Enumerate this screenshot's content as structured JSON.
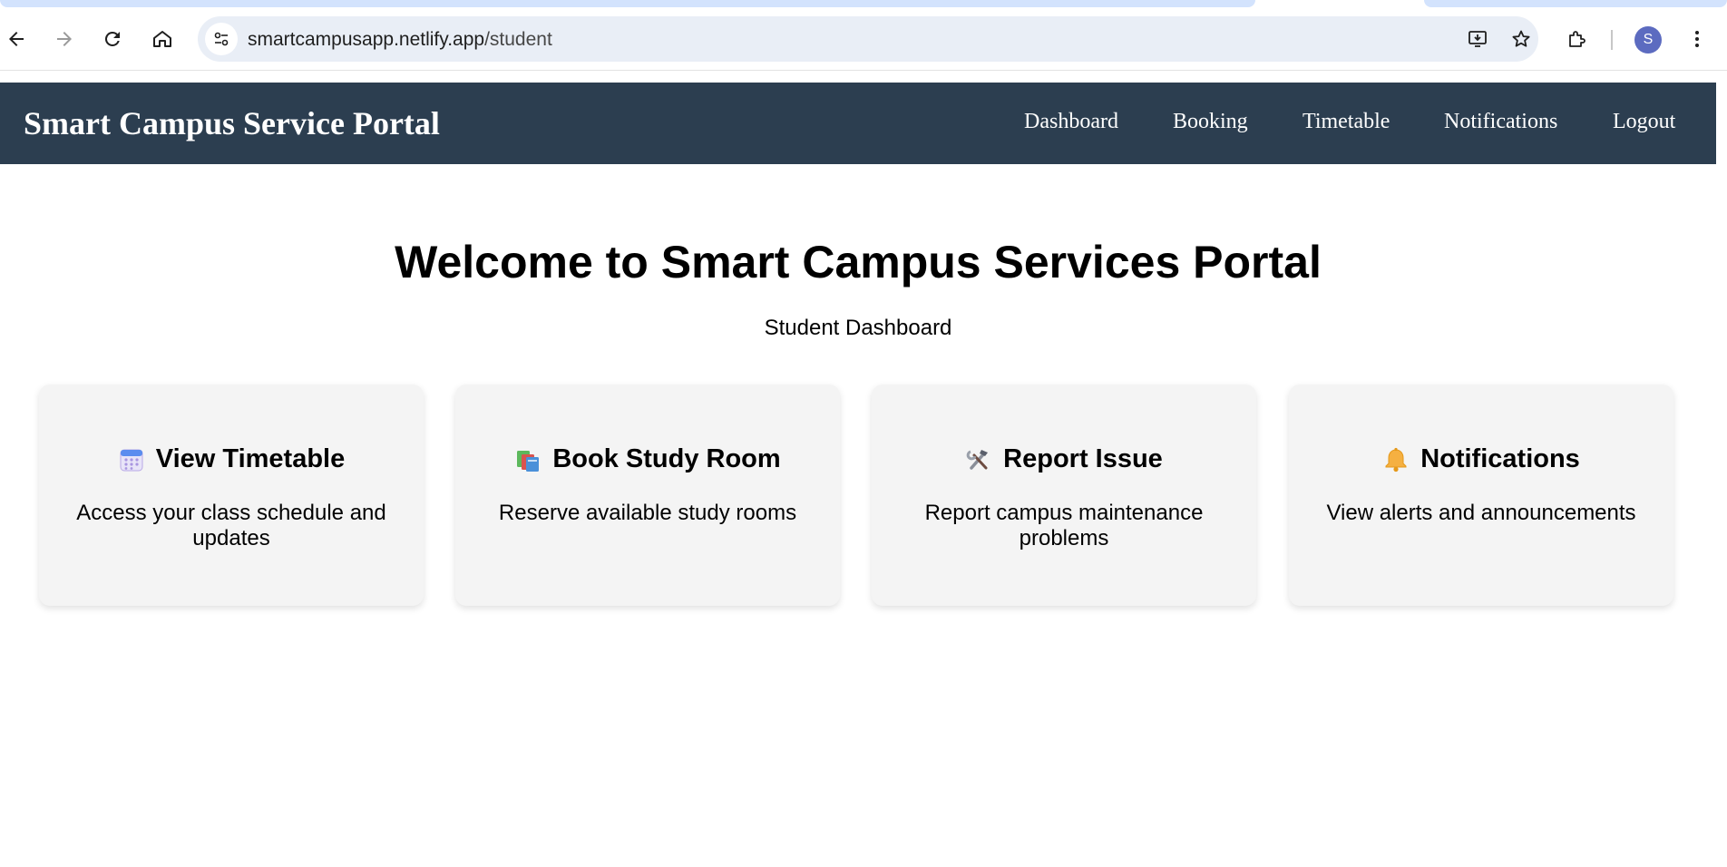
{
  "browser": {
    "url_host": "smartcampusapp.netlify.app",
    "url_path": "/student",
    "profile_initial": "S"
  },
  "header": {
    "brand": "Smart Campus Service Portal",
    "nav": [
      "Dashboard",
      "Booking",
      "Timetable",
      "Notifications",
      "Logout"
    ]
  },
  "main": {
    "title": "Welcome to Smart Campus Services Portal",
    "subtitle": "Student Dashboard",
    "cards": [
      {
        "icon": "calendar-icon",
        "title": "View Timetable",
        "description": "Access your class schedule and updates"
      },
      {
        "icon": "books-icon",
        "title": "Book Study Room",
        "description": "Reserve available study rooms"
      },
      {
        "icon": "hammer-wrench-icon",
        "title": "Report Issue",
        "description": "Report campus maintenance problems"
      },
      {
        "icon": "bell-icon",
        "title": "Notifications",
        "description": "View alerts and announcements"
      }
    ]
  },
  "colors": {
    "header_bg": "#2c3e50",
    "card_bg": "#f4f4f4",
    "omnibox_bg": "#e9eef6",
    "avatar_bg": "#5c6bc0"
  }
}
